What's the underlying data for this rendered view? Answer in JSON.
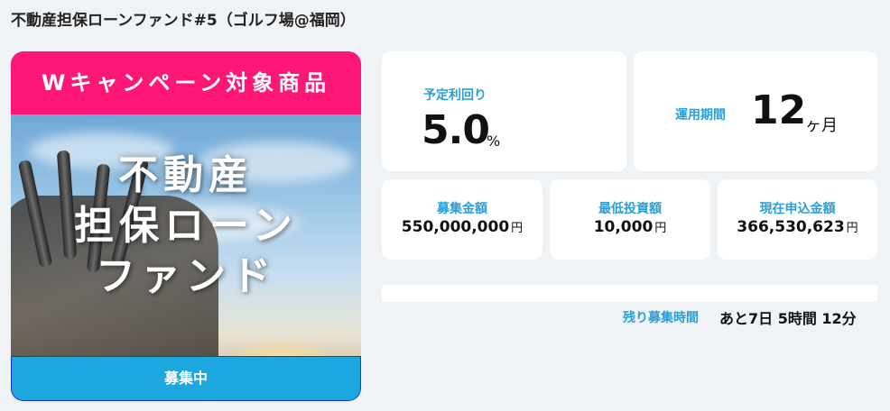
{
  "title": "不動産担保ローンファンド#5（ゴルフ場@福岡）",
  "campaign_banner": "Wキャンペーン対象商品",
  "hero_title_lines": [
    "不動産",
    "担保ローン",
    "ファンド"
  ],
  "status_button": "募集中",
  "yield": {
    "label": "予定利回り",
    "value": "5.0",
    "unit": "%"
  },
  "term": {
    "label": "運用期間",
    "value": "12",
    "unit": "ヶ月"
  },
  "target_amount": {
    "label": "募集金額",
    "value": "550,000,000",
    "unit": "円"
  },
  "min_investment": {
    "label": "最低投資額",
    "value": "10,000",
    "unit": "円"
  },
  "current_application": {
    "label": "現在申込金額",
    "value": "366,530,623",
    "unit": "円"
  },
  "progress": {
    "fraction": 0.0
  },
  "remaining": {
    "label": "残り募集時間",
    "value": "あと7日 5時間 12分"
  },
  "colors": {
    "accent": "#2a9fd6",
    "banner": "#ff1777",
    "button": "#1ca7df",
    "background": "#f0f3f6"
  }
}
